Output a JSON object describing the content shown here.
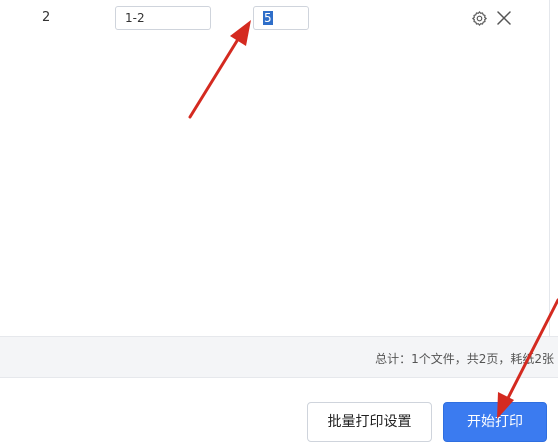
{
  "table": {
    "rows": [
      {
        "index": "2",
        "page_range": "1-2",
        "copies": "5"
      }
    ]
  },
  "summary": {
    "text": "总计：1个文件，共2页，耗纸2张"
  },
  "footer": {
    "batch_settings_label": "批量打印设置",
    "start_print_label": "开始打印"
  },
  "colors": {
    "primary": "#3b7bf0",
    "annotation_arrow": "#d42a20",
    "selection": "#2e6ec9"
  },
  "icons": [
    "gear-icon",
    "close-icon",
    "annotation-arrow"
  ]
}
